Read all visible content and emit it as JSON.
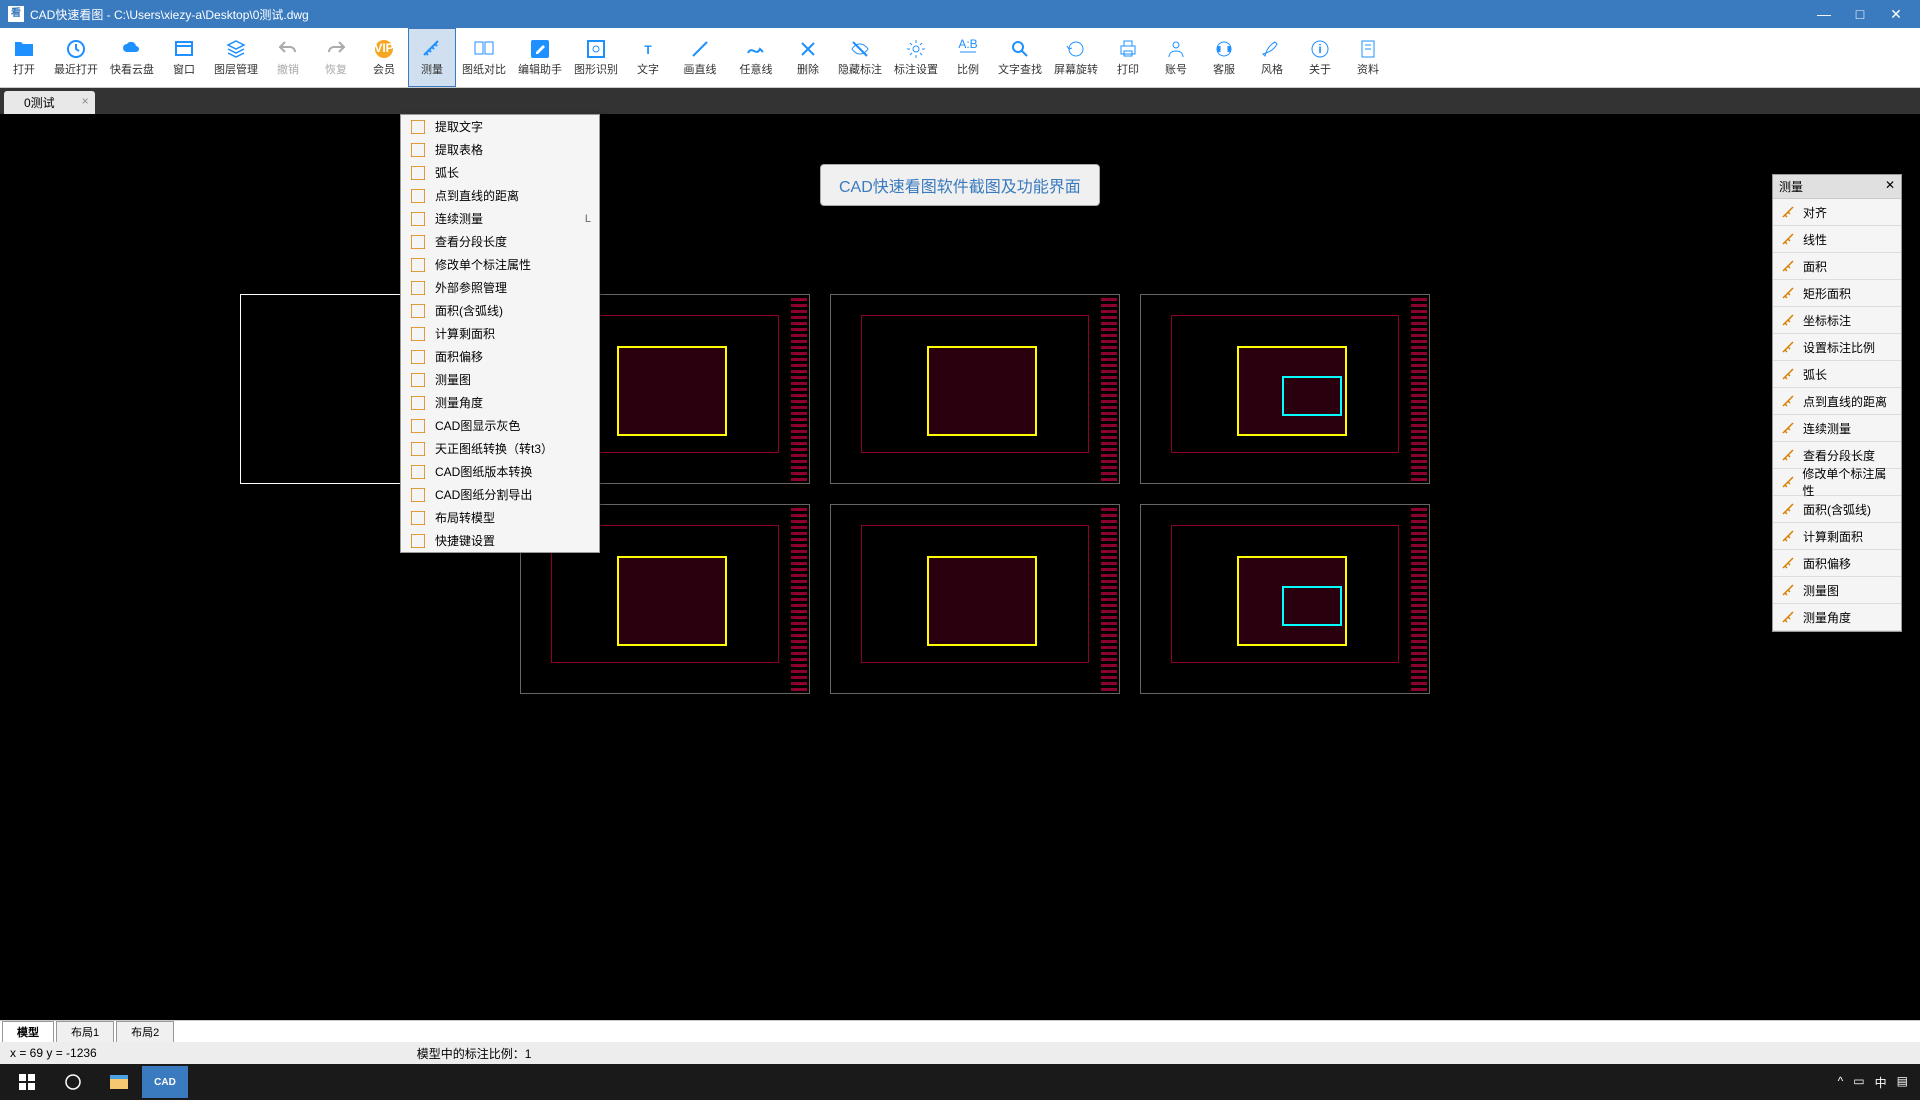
{
  "title": "CAD快速看图 - C:\\Users\\xiezy-a\\Desktop\\0测试.dwg",
  "window_buttons": {
    "min": "—",
    "max": "□",
    "close": "✕"
  },
  "toolbar": [
    {
      "label": "打开",
      "icon": "folder",
      "color": "#1e90ff"
    },
    {
      "label": "最近打开",
      "icon": "clock",
      "color": "#1e90ff"
    },
    {
      "label": "快看云盘",
      "icon": "cloud",
      "color": "#1e90ff"
    },
    {
      "label": "窗口",
      "icon": "window",
      "color": "#1e90ff"
    },
    {
      "label": "图层管理",
      "icon": "layers",
      "color": "#1e90ff"
    },
    {
      "label": "撤销",
      "icon": "undo",
      "color": "#aaa",
      "disabled": true
    },
    {
      "label": "恢复",
      "icon": "redo",
      "color": "#aaa",
      "disabled": true
    },
    {
      "label": "会员",
      "icon": "vip",
      "color": "#f5a623"
    },
    {
      "label": "测量",
      "icon": "measure",
      "color": "#1e90ff",
      "active": true
    },
    {
      "label": "图纸对比",
      "icon": "compare",
      "color": "#1e90ff"
    },
    {
      "label": "编辑助手",
      "icon": "edit",
      "color": "#1e90ff"
    },
    {
      "label": "图形识别",
      "icon": "recognize",
      "color": "#1e90ff"
    },
    {
      "label": "文字",
      "icon": "text",
      "color": "#1e90ff"
    },
    {
      "label": "画直线",
      "icon": "line",
      "color": "#1e90ff"
    },
    {
      "label": "任意线",
      "icon": "freeline",
      "color": "#1e90ff"
    },
    {
      "label": "删除",
      "icon": "delete",
      "color": "#1e90ff"
    },
    {
      "label": "隐藏标注",
      "icon": "hide",
      "color": "#1e90ff"
    },
    {
      "label": "标注设置",
      "icon": "settings",
      "color": "#1e90ff"
    },
    {
      "label": "比例",
      "icon": "scale",
      "color": "#1e90ff"
    },
    {
      "label": "文字查找",
      "icon": "find",
      "color": "#1e90ff"
    },
    {
      "label": "屏幕旋转",
      "icon": "rotate",
      "color": "#1e90ff"
    },
    {
      "label": "打印",
      "icon": "print",
      "color": "#1e90ff"
    },
    {
      "label": "账号",
      "icon": "account",
      "color": "#1e90ff"
    },
    {
      "label": "客服",
      "icon": "support",
      "color": "#1e90ff"
    },
    {
      "label": "风格",
      "icon": "style",
      "color": "#1e90ff"
    },
    {
      "label": "关于",
      "icon": "about",
      "color": "#1e90ff"
    },
    {
      "label": "资料",
      "icon": "docs",
      "color": "#1e90ff"
    }
  ],
  "tab": {
    "name": "0测试",
    "close": "×"
  },
  "dropdown": [
    {
      "label": "提取文字",
      "icon": "#d97f00"
    },
    {
      "label": "提取表格",
      "icon": "#d97f00"
    },
    {
      "label": "弧长",
      "icon": "#d97f00"
    },
    {
      "label": "点到直线的距离",
      "icon": "#d97f00"
    },
    {
      "label": "连续测量",
      "icon": "#d97f00",
      "shortcut": "L"
    },
    {
      "label": "查看分段长度",
      "icon": "#d97f00"
    },
    {
      "label": "修改单个标注属性",
      "icon": "#d97f00"
    },
    {
      "label": "外部参照管理",
      "icon": "#d97f00"
    },
    {
      "label": "面积(含弧线)",
      "icon": "#d97f00"
    },
    {
      "label": "计算剩面积",
      "icon": "#d97f00"
    },
    {
      "label": "面积偏移",
      "icon": "#d97f00"
    },
    {
      "label": "测量图",
      "icon": "#d97f00"
    },
    {
      "label": "测量角度",
      "icon": "#d97f00"
    },
    {
      "label": "CAD图显示灰色",
      "icon": "#d97f00"
    },
    {
      "label": "天正图纸转换（转t3）",
      "icon": "#d97f00"
    },
    {
      "label": "CAD图纸版本转换",
      "icon": "#d97f00"
    },
    {
      "label": "CAD图纸分割导出",
      "icon": "#d97f00"
    },
    {
      "label": "布局转模型",
      "icon": "#d97f00"
    },
    {
      "label": "快捷键设置",
      "icon": "#d97f00"
    }
  ],
  "banner": "CAD快速看图软件截图及功能界面",
  "panel": {
    "title": "测量",
    "close": "✕",
    "items": [
      {
        "label": "对齐"
      },
      {
        "label": "线性"
      },
      {
        "label": "面积"
      },
      {
        "label": "矩形面积"
      },
      {
        "label": "坐标标注"
      },
      {
        "label": "设置标注比例"
      },
      {
        "label": "弧长"
      },
      {
        "label": "点到直线的距离"
      },
      {
        "label": "连续测量"
      },
      {
        "label": "查看分段长度"
      },
      {
        "label": "修改单个标注属性"
      },
      {
        "label": "面积(含弧线)"
      },
      {
        "label": "计算剩面积"
      },
      {
        "label": "面积偏移"
      },
      {
        "label": "测量图"
      },
      {
        "label": "测量角度"
      }
    ]
  },
  "bottom_tabs": [
    "模型",
    "布局1",
    "布局2"
  ],
  "status": {
    "coords": "x = 69  y = -1236",
    "info": "模型中的标注比例：1"
  }
}
